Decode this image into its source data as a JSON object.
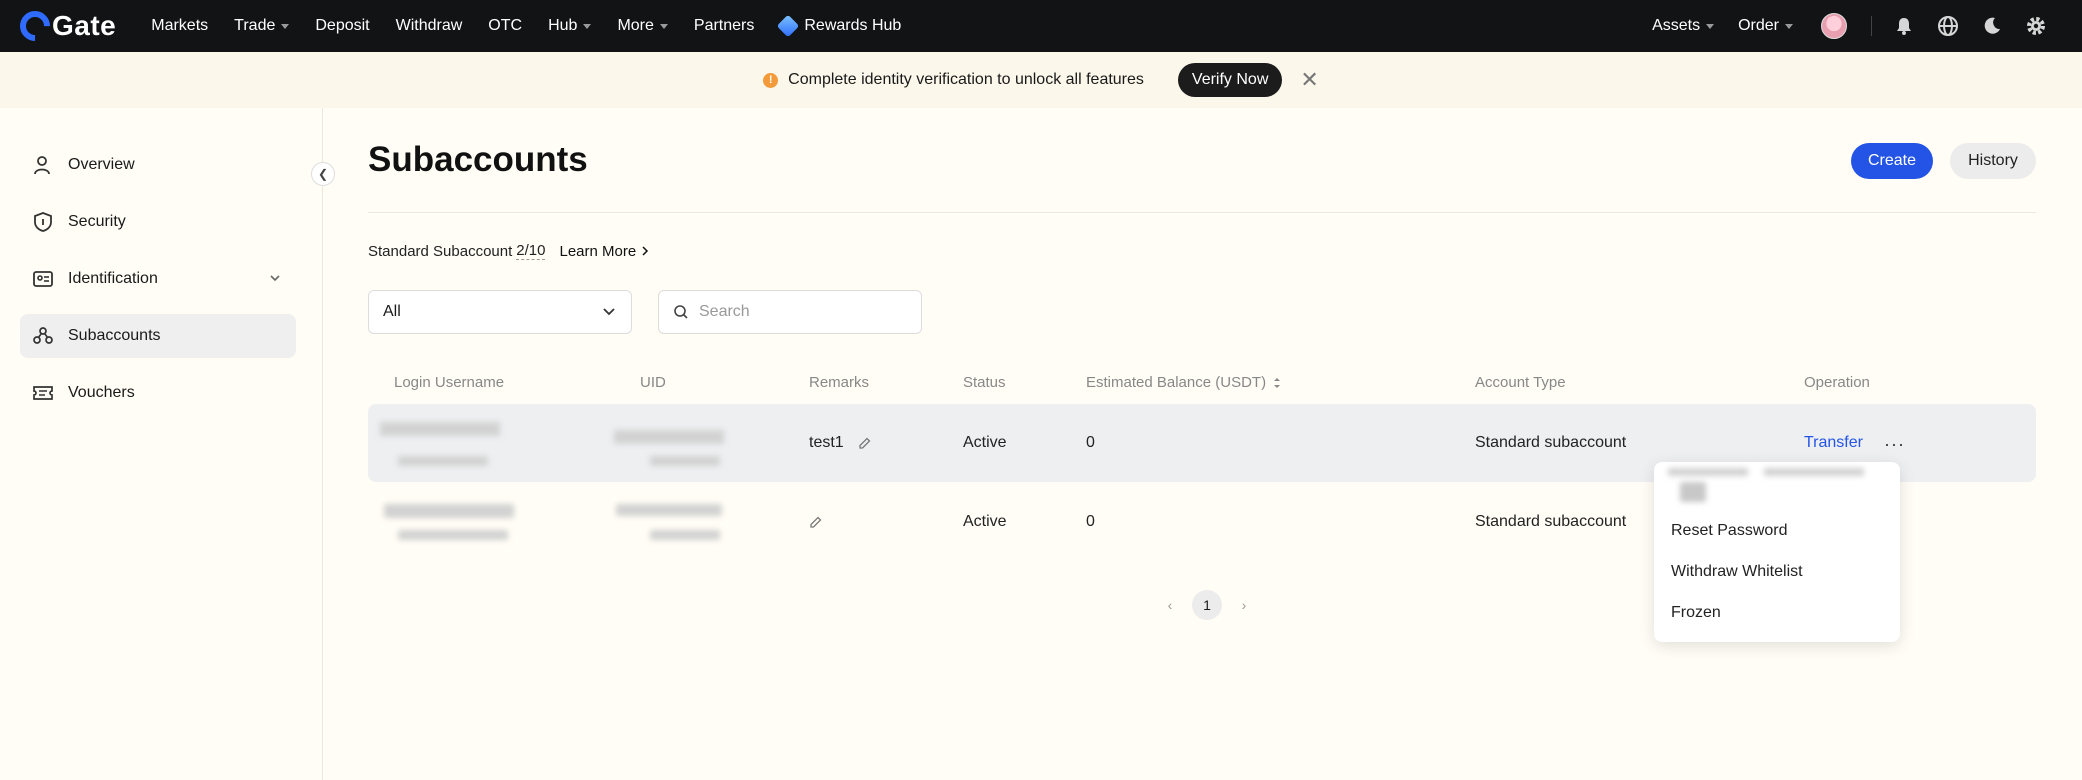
{
  "topbar": {
    "logo_text": "Gate",
    "nav": [
      {
        "label": "Markets",
        "caret": false
      },
      {
        "label": "Trade",
        "caret": true
      },
      {
        "label": "Deposit",
        "caret": false
      },
      {
        "label": "Withdraw",
        "caret": false
      },
      {
        "label": "OTC",
        "caret": false
      },
      {
        "label": "Hub",
        "caret": true
      },
      {
        "label": "More",
        "caret": true
      },
      {
        "label": "Partners",
        "caret": false
      }
    ],
    "rewards_label": "Rewards Hub",
    "assets_label": "Assets",
    "order_label": "Order",
    "icons": [
      "bell-icon",
      "globe-icon",
      "moon-icon",
      "gear-icon"
    ]
  },
  "banner": {
    "message": "Complete identity verification to unlock all features",
    "verify_label": "Verify Now",
    "warn_glyph": "!",
    "close_glyph": "✕"
  },
  "sidebar": {
    "items": [
      {
        "label": "Overview",
        "icon": "user-icon"
      },
      {
        "label": "Security",
        "icon": "shield-icon"
      },
      {
        "label": "Identification",
        "icon": "id-card-icon"
      },
      {
        "label": "Subaccounts",
        "icon": "subaccounts-icon"
      },
      {
        "label": "Vouchers",
        "icon": "voucher-icon"
      }
    ],
    "active_index": 3,
    "collapse_glyph": "❮"
  },
  "main": {
    "title": "Subaccounts",
    "create_label": "Create",
    "history_label": "History",
    "quota_label": "Standard Subaccount",
    "quota_value": "2/10",
    "learn_more": "Learn More",
    "filter_value": "All",
    "search_placeholder": "Search",
    "columns": [
      "Login Username",
      "UID",
      "Remarks",
      "Status",
      "Estimated Balance (USDT)",
      "Account Type",
      "Operation"
    ],
    "rows": [
      {
        "remarks": "test1",
        "status": "Active",
        "balance": "0",
        "type": "Standard subaccount",
        "operation": "Transfer",
        "more": "···"
      },
      {
        "remarks": "",
        "status": "Active",
        "balance": "0",
        "type": "Standard subaccount"
      }
    ],
    "dropdown": [
      "Reset Password",
      "Withdraw Whitelist",
      "Frozen"
    ],
    "pagination": {
      "current": "1",
      "prev": "‹",
      "next": "›"
    }
  },
  "colors": {
    "accent": "#2354e6",
    "nav_bg": "#121314",
    "warn": "#f39b3b"
  }
}
